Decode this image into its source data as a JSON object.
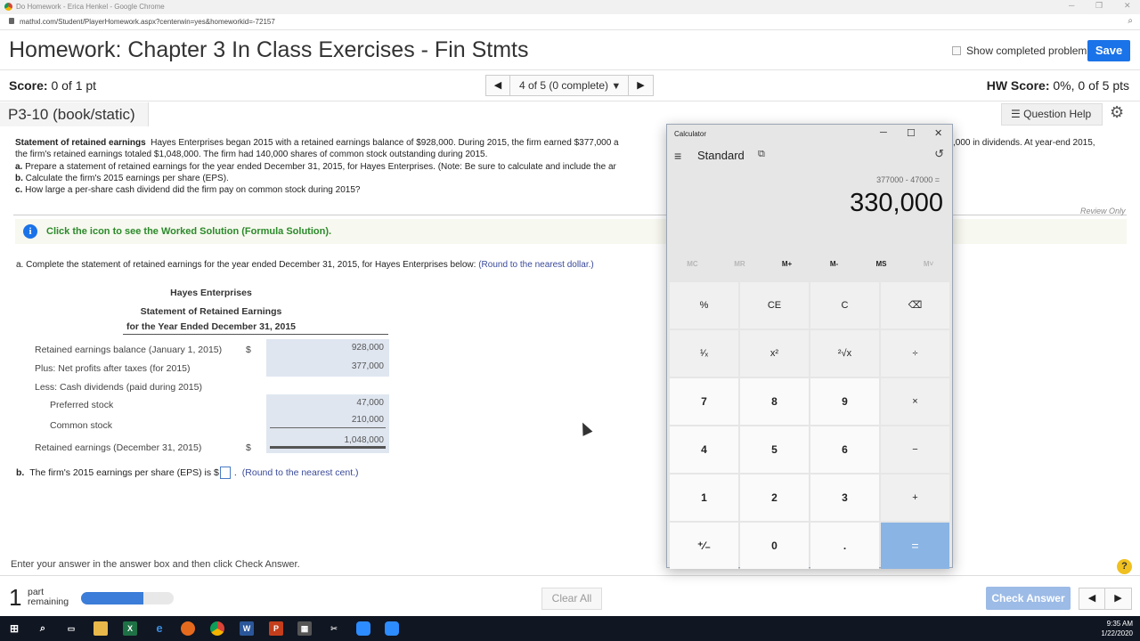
{
  "browser": {
    "window_title": "Do Homework - Erica Henkel - Google Chrome",
    "url": "mathxl.com/Student/PlayerHomework.aspx?centerwin=yes&homeworkid=-72157"
  },
  "header": {
    "title": "Homework: Chapter 3 In Class Exercises - Fin Stmts",
    "show_completed_label": "Show completed problem",
    "save_label": "Save"
  },
  "score": {
    "label": "Score:",
    "value": "0 of 1 pt",
    "nav_label": "4 of 5 (0 complete)",
    "hw_label": "HW Score:",
    "hw_value": "0%, 0 of 5 pts"
  },
  "problem": {
    "id": "P3-10 (book/static)",
    "question_help": "Question Help",
    "statement_title": "Statement of retained earnings",
    "statement_line1": "Hayes Enterprises began 2015 with a retained earnings balance of $928,000. During 2015, the firm earned $377,000 a",
    "statement_line1_tail": ",000 in dividends. At year-end 2015,",
    "statement_line2": "the firm's retained earnings totaled $1,048,000. The firm had 140,000 shares of common stock outstanding during 2015.",
    "qa_prefix": "a.",
    "qa": "Prepare a statement of retained earnings for the year ended December 31, 2015, for Hayes Enterprises. (Note: Be sure to calculate and include the ar",
    "qb_prefix": "b.",
    "qb": "Calculate the firm's 2015 earnings per share (EPS).",
    "qc_prefix": "c.",
    "qc": "How large a per-share cash dividend did the firm pay on common stock during 2015?",
    "review_only": "Review Only",
    "worked_solution": "Click the icon to see the Worked Solution (Formula Solution)."
  },
  "part_a": {
    "prefix": "a.",
    "text": "Complete the statement of retained earnings for the year ended December 31, 2015, for Hayes Enterprises below:",
    "hint": "(Round to the nearest dollar.)",
    "company": "Hayes Enterprises",
    "statement_name": "Statement of Retained Earnings",
    "period": "for the Year Ended December 31, 2015",
    "rows": [
      {
        "label": "Retained earnings balance (January 1, 2015)",
        "dollar": "$",
        "value": "928,000"
      },
      {
        "label": "Plus: Net profits after taxes (for 2015)",
        "dollar": "",
        "value": "377,000"
      },
      {
        "label": "Less: Cash dividends (paid during 2015)",
        "dollar": "",
        "value": ""
      },
      {
        "label": "Preferred stock",
        "dollar": "",
        "value": "47,000"
      },
      {
        "label": "Common stock",
        "dollar": "",
        "value": "210,000"
      },
      {
        "label": "Retained earnings (December 31, 2015)",
        "dollar": "$",
        "value": "1,048,000"
      }
    ]
  },
  "part_b": {
    "prefix": "b.",
    "text": "The firm's 2015 earnings per share (EPS) is $",
    "input_value": "",
    "hint": "(Round to the nearest cent.)"
  },
  "footer": {
    "instruction": "Enter your answer in the answer box and then click Check Answer.",
    "parts_count": "1",
    "parts_label_1": "part",
    "parts_label_2": "remaining",
    "progress_fraction": 0.67,
    "clear_all": "Clear All",
    "check_answer": "Check Answer",
    "help": "?"
  },
  "calculator": {
    "window_title": "Calculator",
    "mode": "Standard",
    "expression": "377000 - 47000 =",
    "result": "330,000",
    "memory": [
      "MC",
      "MR",
      "M+",
      "M-",
      "MS",
      "M˅"
    ],
    "keys": [
      [
        "%",
        "CE",
        "C",
        "⌫"
      ],
      [
        "¹⁄ₓ",
        "x²",
        "²√x",
        "÷"
      ],
      [
        "7",
        "8",
        "9",
        "×"
      ],
      [
        "4",
        "5",
        "6",
        "−"
      ],
      [
        "1",
        "2",
        "3",
        "+"
      ],
      [
        "⁺⁄₋",
        "0",
        ".",
        "="
      ]
    ]
  },
  "taskbar": {
    "time": "9:35 AM",
    "date": "1/22/2020"
  },
  "colors": {
    "accent": "#1a73e8",
    "answer_fill": "#dfe6f0",
    "worked_text": "#2a8a2a",
    "equals_key": "#8ab4e3"
  }
}
